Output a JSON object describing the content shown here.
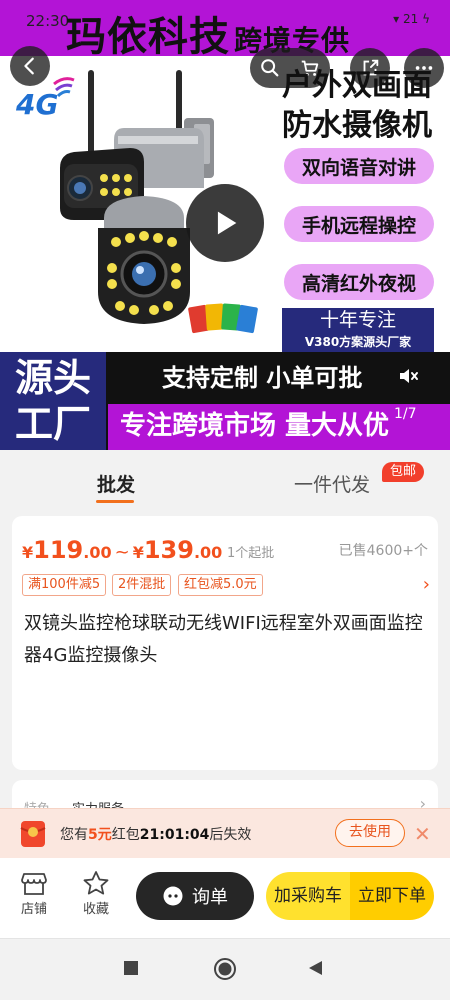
{
  "status_bar": {
    "time": "22:30",
    "battery": "21"
  },
  "hero": {
    "brand_title": "玛依科技",
    "brand_sub": "跨境专供",
    "network_badge": "4G",
    "headline": [
      "户外双画面",
      "防水摄像机"
    ],
    "features": [
      "双向语音对讲",
      "手机远程操控",
      "高清红外夜视"
    ],
    "decade_line1": "十年专注",
    "decade_line2": "V380方案源头厂家",
    "source_box": [
      "源头",
      "工厂"
    ],
    "banner_top": "支持定制  小单可批",
    "banner_bottom": "专注跨境市场  量大从优",
    "page_indicator": "1/7",
    "icons": {
      "back": "back-arrow-icon",
      "search": "search-icon",
      "cart": "cart-icon",
      "share": "share-icon",
      "more": "more-dots-icon",
      "play": "play-icon",
      "mute": "mute-icon"
    }
  },
  "tabs": {
    "wholesale": "批发",
    "dropship": "一件代发",
    "badge": "包邮"
  },
  "product": {
    "price_low_int": "119",
    "price_low_dec": ".00",
    "price_high_int": "139",
    "price_high_dec": ".00",
    "currency": "¥",
    "range_sep": "~",
    "moq": "1个起批",
    "sold": "已售4600+个",
    "coupons": [
      "满100件减5",
      "2件混批",
      "红包减5.0元"
    ],
    "title": "双镜头监控枪球联动无线WIFI远程室外双画面监控器4G监控摄像头"
  },
  "service": {
    "label": "特色",
    "value": "实力服务"
  },
  "red_packet": {
    "prefix": "您有",
    "amount": "5元",
    "middle": "红包",
    "countdown": "21:01:04",
    "suffix": "后失效",
    "button": "去使用"
  },
  "actions": {
    "store": "店铺",
    "favorite": "收藏",
    "inquiry": "询单",
    "add_cart": "加采购车",
    "buy_now": "立即下单"
  },
  "colors": {
    "accent": "#f2501d",
    "purple": "#b314d6",
    "navy": "#262a7c",
    "yellow": "#ffcd00"
  }
}
